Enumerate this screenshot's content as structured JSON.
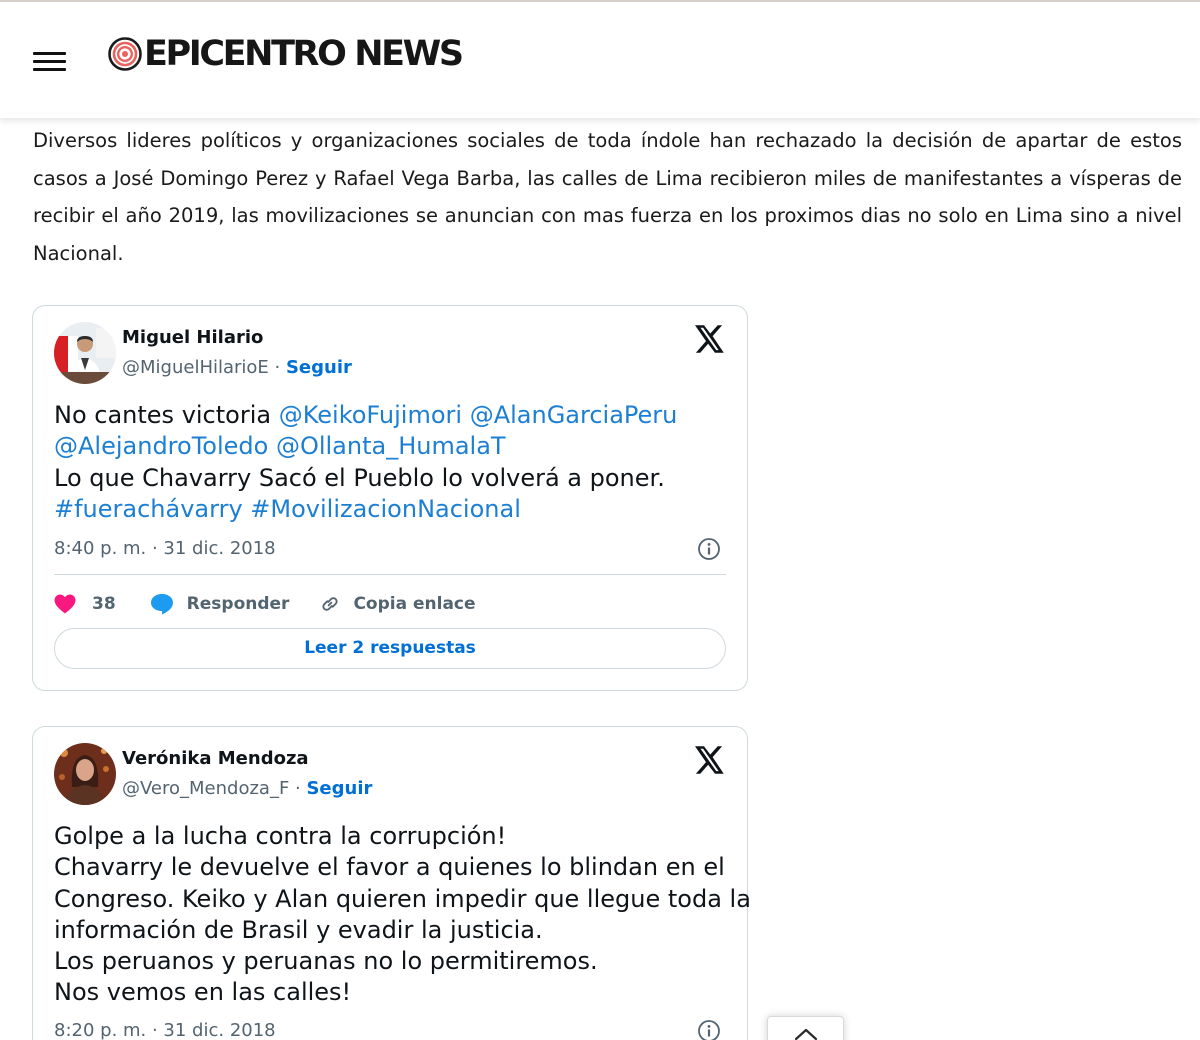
{
  "site": {
    "logo_text": "EPICENTRO NEWS",
    "menu_icon": "hamburger-menu-icon",
    "logo_icon": "concentric-circles-icon"
  },
  "article": {
    "paragraph": "Diversos lideres políticos y organizaciones sociales de toda índole han rechazado la decisión de apartar de estos casos a José Domingo Perez y Rafael Vega Barba, las calles de Lima recibieron miles de manifestantes a vísperas de recibir el año 2019, las movilizaciones se anuncian con mas fuerza en los proximos dias no solo en Lima sino a nivel Nacional."
  },
  "tweets": [
    {
      "name": "Miguel Hilario",
      "handle": "@MiguelHilarioE",
      "separator": " · ",
      "follow": "Seguir",
      "text_plain_1": "No cantes victoria ",
      "mention_1": "@KeikoFujimori",
      "space_1": " ",
      "mention_2": "@AlanGarciaPeru",
      "mention_3": "@AlejandroToledo",
      "space_2": " ",
      "mention_4": "@Ollanta_HumalaT",
      "text_line_3": "Lo que Chavarry Sacó el Pueblo lo volverá a poner.",
      "hashtag_1": "#fuerachávarry",
      "space_3": " ",
      "hashtag_2": "#MovilizacionNacional",
      "timestamp": "8:40 p. m. · 31 dic. 2018",
      "likes": "38",
      "reply_label": "Responder",
      "copy_label": "Copia enlace",
      "read_replies": "Leer 2 respuestas"
    },
    {
      "name": "Verónika Mendoza",
      "handle": "@Vero_Mendoza_F",
      "separator": " · ",
      "follow": "Seguir",
      "lines": [
        "Golpe a la lucha contra la corrupción!",
        "Chavarry le devuelve el favor a quienes lo blindan en el",
        "Congreso. Keiko y Alan quieren impedir que llegue toda la",
        "información de Brasil y evadir la justicia.",
        "Los peruanos y peruanas no lo permitiremos.",
        "Nos vemos en las calles!"
      ],
      "timestamp": "8:20 p. m. · 31 dic. 2018"
    }
  ],
  "colors": {
    "link": "#1d7fd3",
    "follow": "#006fd6",
    "heart": "#f91880",
    "reply_bubble": "#1d9bf0",
    "muted": "#536471",
    "border": "#cfd9de"
  },
  "icons": {
    "x_logo": "x-logo-icon",
    "info": "info-icon",
    "heart": "heart-icon",
    "reply": "speech-bubble-icon",
    "link": "link-icon",
    "scroll_top": "chevron-up-icon"
  }
}
